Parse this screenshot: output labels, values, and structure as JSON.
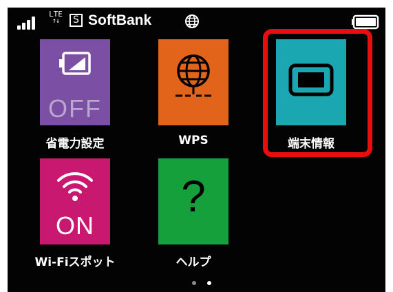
{
  "status_bar": {
    "network_top": "LTE",
    "network_bottom": "↑↓",
    "sim_letter": "S",
    "carrier": "SoftBank",
    "globe_icon": "globe-icon",
    "battery_icon": "battery-full-icon"
  },
  "tiles": [
    {
      "id": "power-saving",
      "label": "省電力設定",
      "icon_text": "OFF",
      "icon": "battery-icon",
      "color": "#7b4fa3"
    },
    {
      "id": "wps",
      "label": "WPS",
      "icon": "globe-network-icon",
      "color": "#e2641b"
    },
    {
      "id": "device-info",
      "label": "端末情報",
      "icon": "device-screen-icon",
      "color": "#1ba7b2",
      "highlighted": true
    },
    {
      "id": "wifi-spot",
      "label": "Wi-Fiスポット",
      "icon_text": "ON",
      "icon": "wifi-icon",
      "color": "#c9186f"
    },
    {
      "id": "help",
      "label": "ヘルプ",
      "icon_text": "?",
      "icon": "help-icon",
      "color": "#16a03c"
    }
  ],
  "pagination": {
    "total": 2,
    "current": 2
  },
  "colors": {
    "highlight": "#ea0d0d",
    "background": "#030303"
  }
}
